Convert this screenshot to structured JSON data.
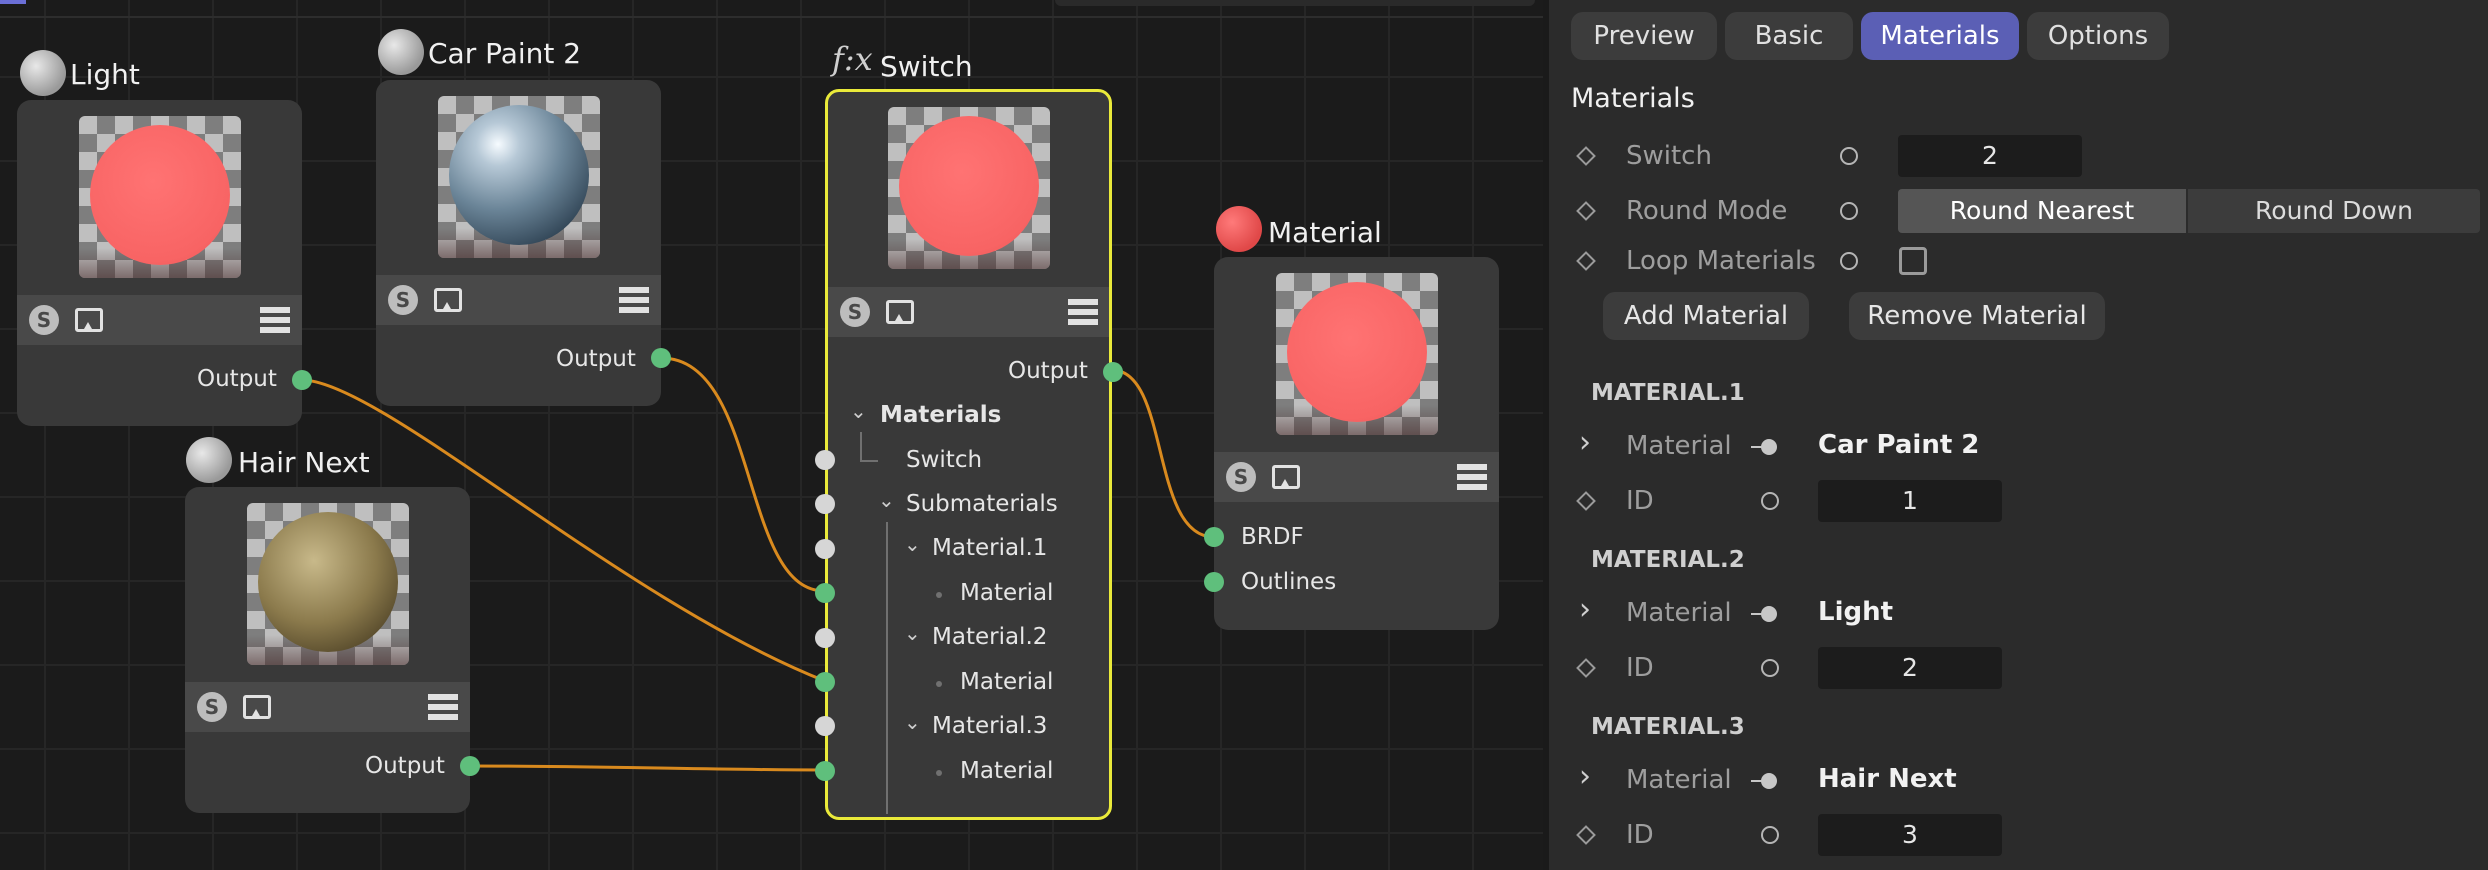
{
  "nodes": {
    "light": {
      "title": "Light",
      "output": "Output"
    },
    "car_paint": {
      "title": "Car Paint 2",
      "output": "Output"
    },
    "hair_next": {
      "title": "Hair Next",
      "output": "Output"
    },
    "switch": {
      "title": "Switch",
      "fx": "f:x",
      "output": "Output",
      "ports": {
        "materials": "Materials",
        "switch": "Switch",
        "submaterials": "Submaterials",
        "material_1": "Material.1",
        "material_1_child": "Material",
        "material_2": "Material.2",
        "material_2_child": "Material",
        "material_3": "Material.3",
        "material_3_child": "Material"
      }
    },
    "material": {
      "title": "Material",
      "brdf": "BRDF",
      "outlines": "Outlines"
    }
  },
  "toolbar": {
    "s_label": "S"
  },
  "panel": {
    "tabs": [
      {
        "label": "Preview"
      },
      {
        "label": "Basic"
      },
      {
        "label": "Materials"
      },
      {
        "label": "Options"
      }
    ],
    "active_tab": "Materials",
    "section_title": "Materials",
    "switch_label": "Switch",
    "switch_value": "2",
    "round_mode_label": "Round Mode",
    "round_nearest": "Round Nearest",
    "round_down": "Round Down",
    "loop_label": "Loop Materials",
    "add_material": "Add Material",
    "remove_material": "Remove Material",
    "entries": [
      {
        "header": "MATERIAL.1",
        "material_label": "Material",
        "material_value": "Car Paint 2",
        "id_label": "ID",
        "id_value": "1"
      },
      {
        "header": "MATERIAL.2",
        "material_label": "Material",
        "material_value": "Light",
        "id_label": "ID",
        "id_value": "2"
      },
      {
        "header": "MATERIAL.3",
        "material_label": "Material",
        "material_value": "Hair Next",
        "id_label": "ID",
        "id_value": "3"
      }
    ]
  },
  "colors": {
    "accent": "#5b5fb5",
    "wire": "#d98a1e",
    "port_connected": "#5fbf7c",
    "selection": "#eaea3a",
    "preview_red": "#f86464"
  }
}
